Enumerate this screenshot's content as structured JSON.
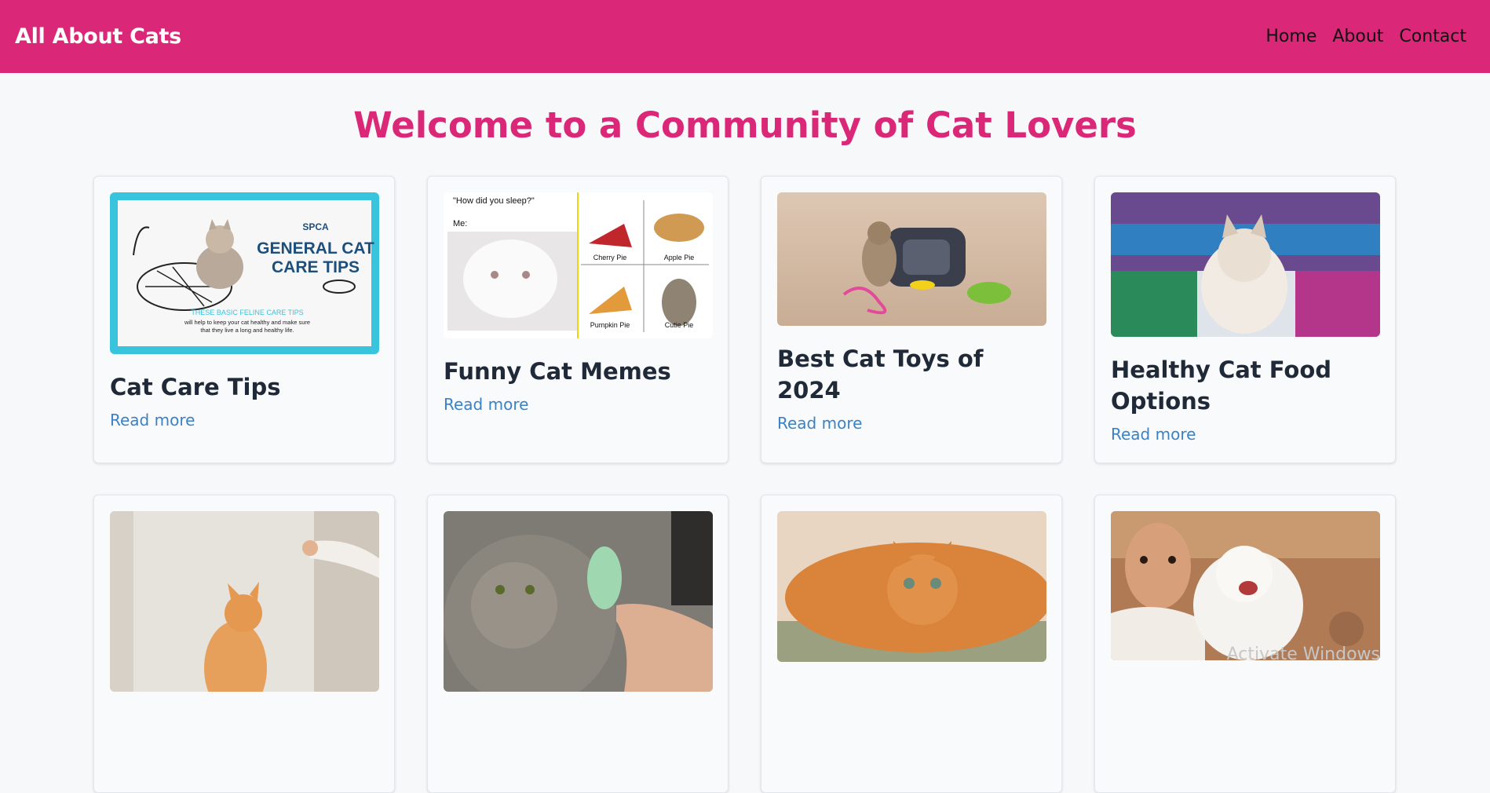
{
  "header": {
    "brand": "All About Cats",
    "nav": [
      "Home",
      "About",
      "Contact"
    ]
  },
  "hero": {
    "title": "Welcome to a Community of Cat Lovers"
  },
  "cards": [
    {
      "title": "Cat Care Tips",
      "link": "Read more",
      "image": {
        "org": "SPCA",
        "heading_line1": "GENERAL CAT",
        "heading_line2": "CARE TIPS",
        "sub": "THESE BASIC FELINE CARE TIPS",
        "body_line1": "will help to keep your cat healthy and make sure",
        "body_line2": "that they live a long and healthy life."
      }
    },
    {
      "title": "Funny Cat Memes",
      "link": "Read more",
      "image": {
        "q": "\"How did you sleep?\"",
        "me": "Me:",
        "labels": [
          "Cherry Pie",
          "Apple Pie",
          "Pumpkin Pie",
          "Cutie Pie"
        ]
      }
    },
    {
      "title": "Best Cat Toys of 2024",
      "link": "Read more"
    },
    {
      "title": "Healthy Cat Food Options",
      "link": "Read more"
    }
  ],
  "watermark": "Activate Windows"
}
